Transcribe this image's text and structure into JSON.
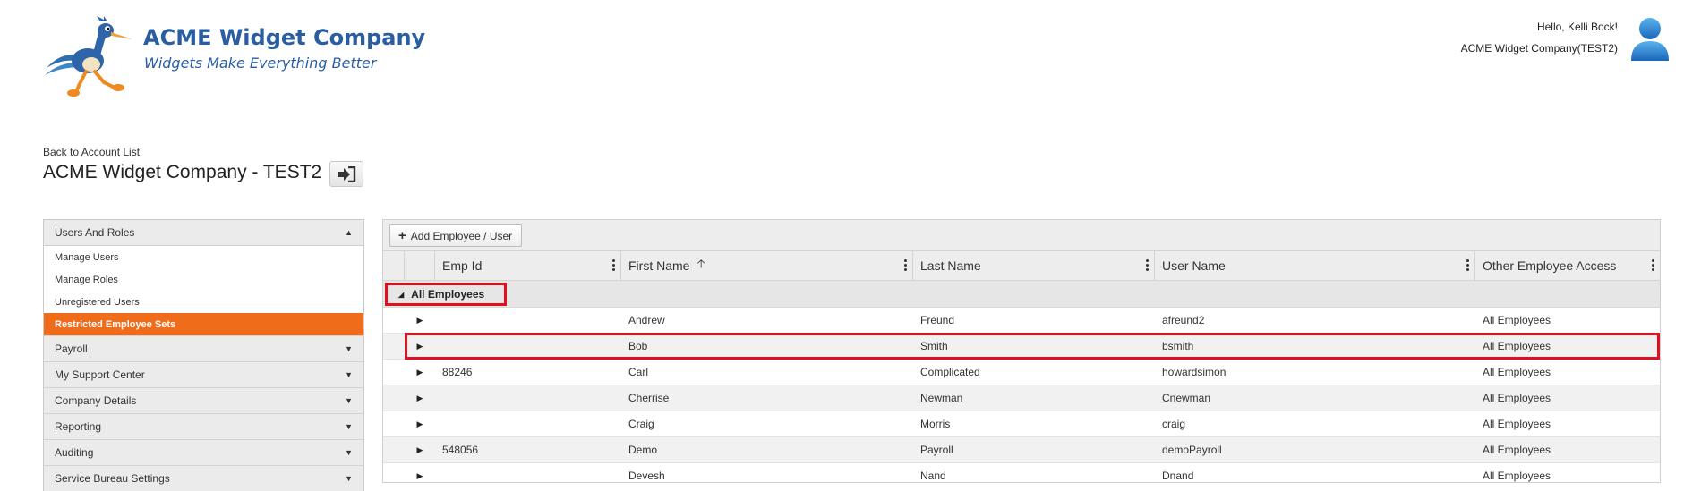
{
  "header": {
    "brand_title": "ACME Widget Company",
    "brand_tagline": "Widgets Make Everything Better",
    "greeting": "Hello, Kelli Bock!",
    "company": "ACME Widget Company(TEST2)",
    "logo_icon": "roadrunner-logo",
    "avatar_icon": "user-avatar-icon"
  },
  "account": {
    "back_link": "Back to Account List",
    "title": "ACME Widget Company - TEST2",
    "switch_icon": "sign-in-icon"
  },
  "sidebar": {
    "open_section": "Users And Roles",
    "sub_items": [
      {
        "label": "Manage Users",
        "active": false
      },
      {
        "label": "Manage Roles",
        "active": false
      },
      {
        "label": "Unregistered Users",
        "active": false
      },
      {
        "label": "Restricted Employee Sets",
        "active": true
      }
    ],
    "sections": [
      "Payroll",
      "My Support Center",
      "Company Details",
      "Reporting",
      "Auditing",
      "Service Bureau Settings"
    ]
  },
  "grid": {
    "add_button": "Add Employee / User",
    "columns": [
      "Emp Id",
      "First Name",
      "Last Name",
      "User Name",
      "Other Employee Access"
    ],
    "sort_column": "First Name",
    "sort_direction": "ascending",
    "group_label": "All Employees",
    "rows": [
      {
        "emp_id": "",
        "first": "Andrew",
        "last": "Freund",
        "user": "afreund2",
        "access": "All Employees"
      },
      {
        "emp_id": "",
        "first": "Bob",
        "last": "Smith",
        "user": "bsmith",
        "access": "All Employees"
      },
      {
        "emp_id": "88246",
        "first": "Carl",
        "last": "Complicated",
        "user": "howardsimon",
        "access": "All Employees"
      },
      {
        "emp_id": "",
        "first": "Cherrise",
        "last": "Newman",
        "user": "Cnewman",
        "access": "All Employees"
      },
      {
        "emp_id": "",
        "first": "Craig",
        "last": "Morris",
        "user": "craig",
        "access": "All Employees"
      },
      {
        "emp_id": "548056",
        "first": "Demo",
        "last": "Payroll",
        "user": "demoPayroll",
        "access": "All Employees"
      },
      {
        "emp_id": "",
        "first": "Devesh",
        "last": "Nand",
        "user": "Dnand",
        "access": "All Employees"
      }
    ],
    "highlighted_row": 1
  },
  "colors": {
    "brand_blue": "#2a5ea3",
    "active_orange": "#ef6c1a",
    "highlight_red": "#e01020"
  }
}
